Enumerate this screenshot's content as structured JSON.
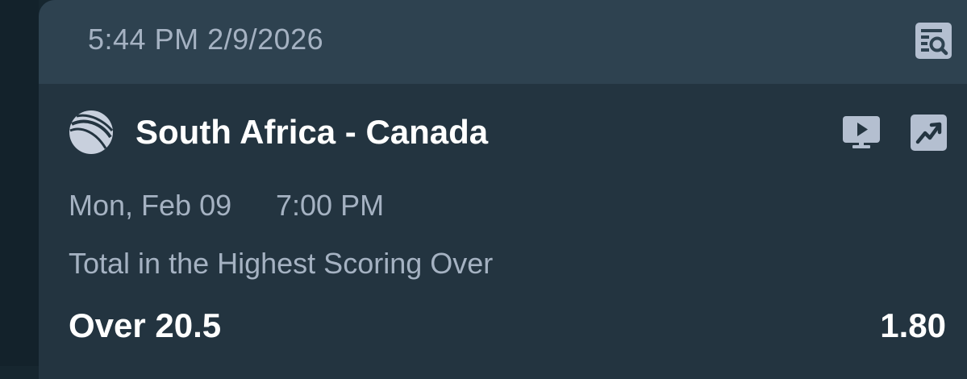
{
  "colors": {
    "background": "#16262f",
    "card": "#233440",
    "card_header": "#2e4250",
    "muted_text": "#a5b2c2",
    "primary_text": "#ffffff",
    "icon_fill": "#b4bfd0"
  },
  "header": {
    "timestamp": "5:44 PM 2/9/2026",
    "action_icon": "search-list-icon"
  },
  "match": {
    "sport_icon": "cricket-ball-icon",
    "title": "South Africa - Canada",
    "date": "Mon, Feb 09",
    "time": "7:00 PM",
    "tv_icon": "live-stream-tv-icon",
    "stats_icon": "stats-trend-icon"
  },
  "bet": {
    "market": "Total in the Highest Scoring Over",
    "selection": "Over 20.5",
    "odds": "1.80"
  }
}
